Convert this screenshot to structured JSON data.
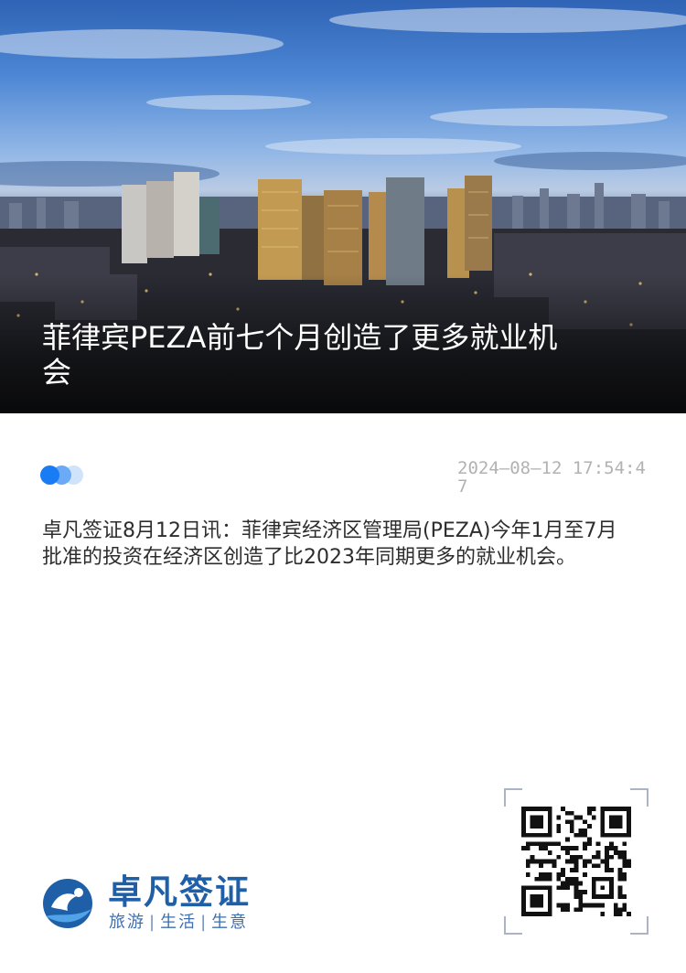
{
  "article": {
    "title": "菲律宾PEZA前七个月创造了更多就业机会",
    "timestamp": "2024—08—12 17:54:47",
    "body": "卓凡签证8月12日讯：菲律宾经济区管理局(PEZA)今年1月至7月批准的投资在经济区创造了比2023年同期更多的就业机会。"
  },
  "hero_image": {
    "subject": "city-skyline-dusk"
  },
  "brand": {
    "name": "卓凡签证",
    "tagline": [
      "旅游",
      "生活",
      "生意"
    ],
    "tagline_separator": "|",
    "color": "#1f5fa8"
  },
  "qr_code": {
    "icon": "qr-code-icon"
  },
  "colors": {
    "accent": "#1a7cf5",
    "timestamp": "#b2b2b2",
    "body_text": "#2d2d2d"
  }
}
